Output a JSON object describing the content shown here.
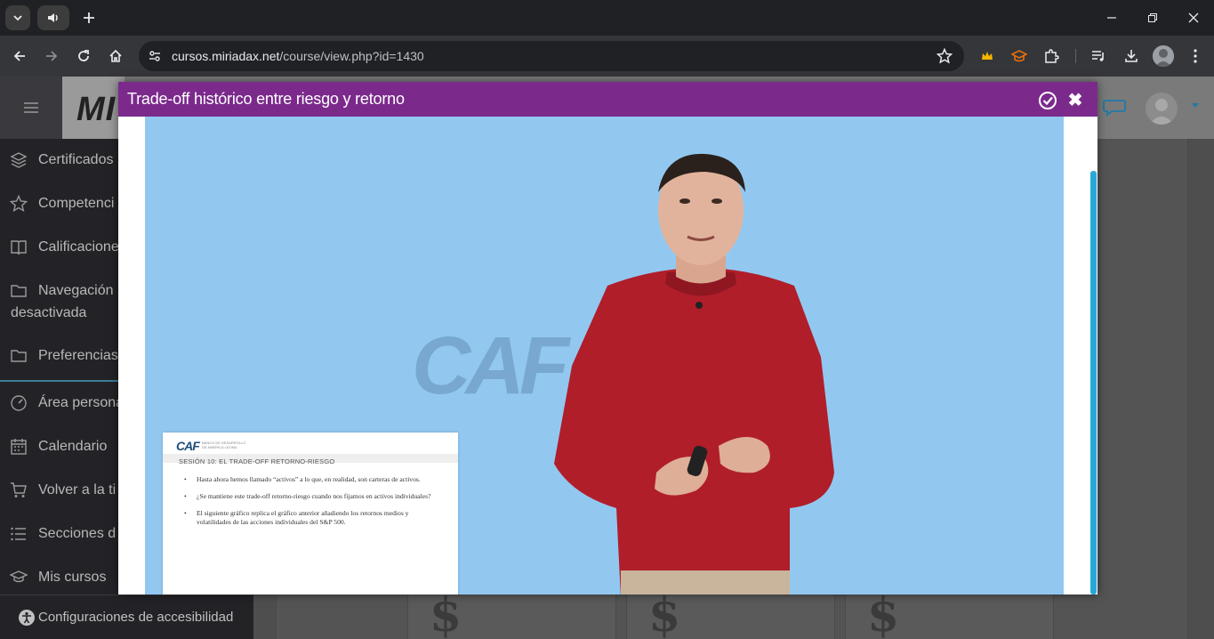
{
  "browser": {
    "url_domain": "cursos.miriadax.net",
    "url_path": "/course/view.php?id=1430"
  },
  "site": {
    "logo_text": "MI"
  },
  "drawer": {
    "items": [
      {
        "label": "Certificados",
        "icon": "layers-icon"
      },
      {
        "label": "Competenci",
        "icon": "star-icon"
      },
      {
        "label": "Calificacione",
        "icon": "book-icon"
      },
      {
        "label": "Navegación",
        "label2": "desactivada",
        "icon": "folder-icon"
      },
      {
        "label": "Preferencias",
        "icon": "folder-icon"
      },
      {
        "label": "Área persona",
        "icon": "dashboard-icon"
      },
      {
        "label": "Calendario",
        "icon": "calendar-icon"
      },
      {
        "label": "Volver a la ti",
        "icon": "cart-icon"
      },
      {
        "label": "Secciones d",
        "icon": "list-icon"
      },
      {
        "label": "Mis cursos",
        "icon": "graduation-cap-icon"
      }
    ],
    "accessibility_label": "Configuraciones de accesibilidad"
  },
  "cards": [
    {
      "symbol": "$"
    },
    {
      "symbol": "$"
    },
    {
      "symbol": "$"
    }
  ],
  "modal": {
    "title": "Trade-off histórico entre riesgo y retorno",
    "close_symbol": "✖"
  },
  "video": {
    "background_logo": "CAF",
    "slide": {
      "logo": "CAF",
      "logo_sub": "BANCO DE DESARROLLO DE AMÉRICA LATINA",
      "title": "SESIÓN 10: EL TRADE-OFF RETORNO-RIESGO",
      "bullets": [
        "Hasta ahora hemos llamado “activos” a lo que, en realidad, son carteras de activos.",
        "¿Se mantiene este trade-off retorno-riesgo cuando nos fijamos en activos individuales?",
        "El siguiente gráfico replica el gráfico anterior añadiendo los retornos medios y volatilidades de las acciones individuales del S&P 500."
      ]
    }
  },
  "colors": {
    "modal_header": "#7b2a8c",
    "video_background": "#92c8f0",
    "scrollbar": "#29a8d8",
    "drawer": "#232327"
  }
}
